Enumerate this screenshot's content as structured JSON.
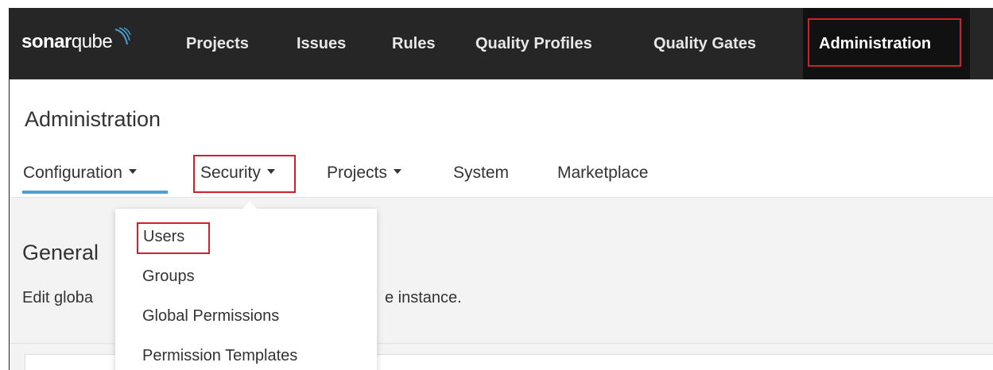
{
  "brand": {
    "bold": "sonar",
    "rest": "qube"
  },
  "topnav": {
    "items": [
      "Projects",
      "Issues",
      "Rules",
      "Quality Profiles",
      "Quality Gates"
    ],
    "active": "Administration"
  },
  "page": {
    "title": "Administration",
    "tabs": [
      "Configuration",
      "Security",
      "Projects",
      "System",
      "Marketplace"
    ]
  },
  "dropdown": {
    "items": [
      "Users",
      "Groups",
      "Global Permissions",
      "Permission Templates"
    ]
  },
  "content": {
    "title": "General",
    "desc_start": "Edit globa",
    "desc_end": "e instance."
  },
  "colors": {
    "topbar": "#262626",
    "accent": "#4b9fd5",
    "highlight": "#d0202b"
  }
}
